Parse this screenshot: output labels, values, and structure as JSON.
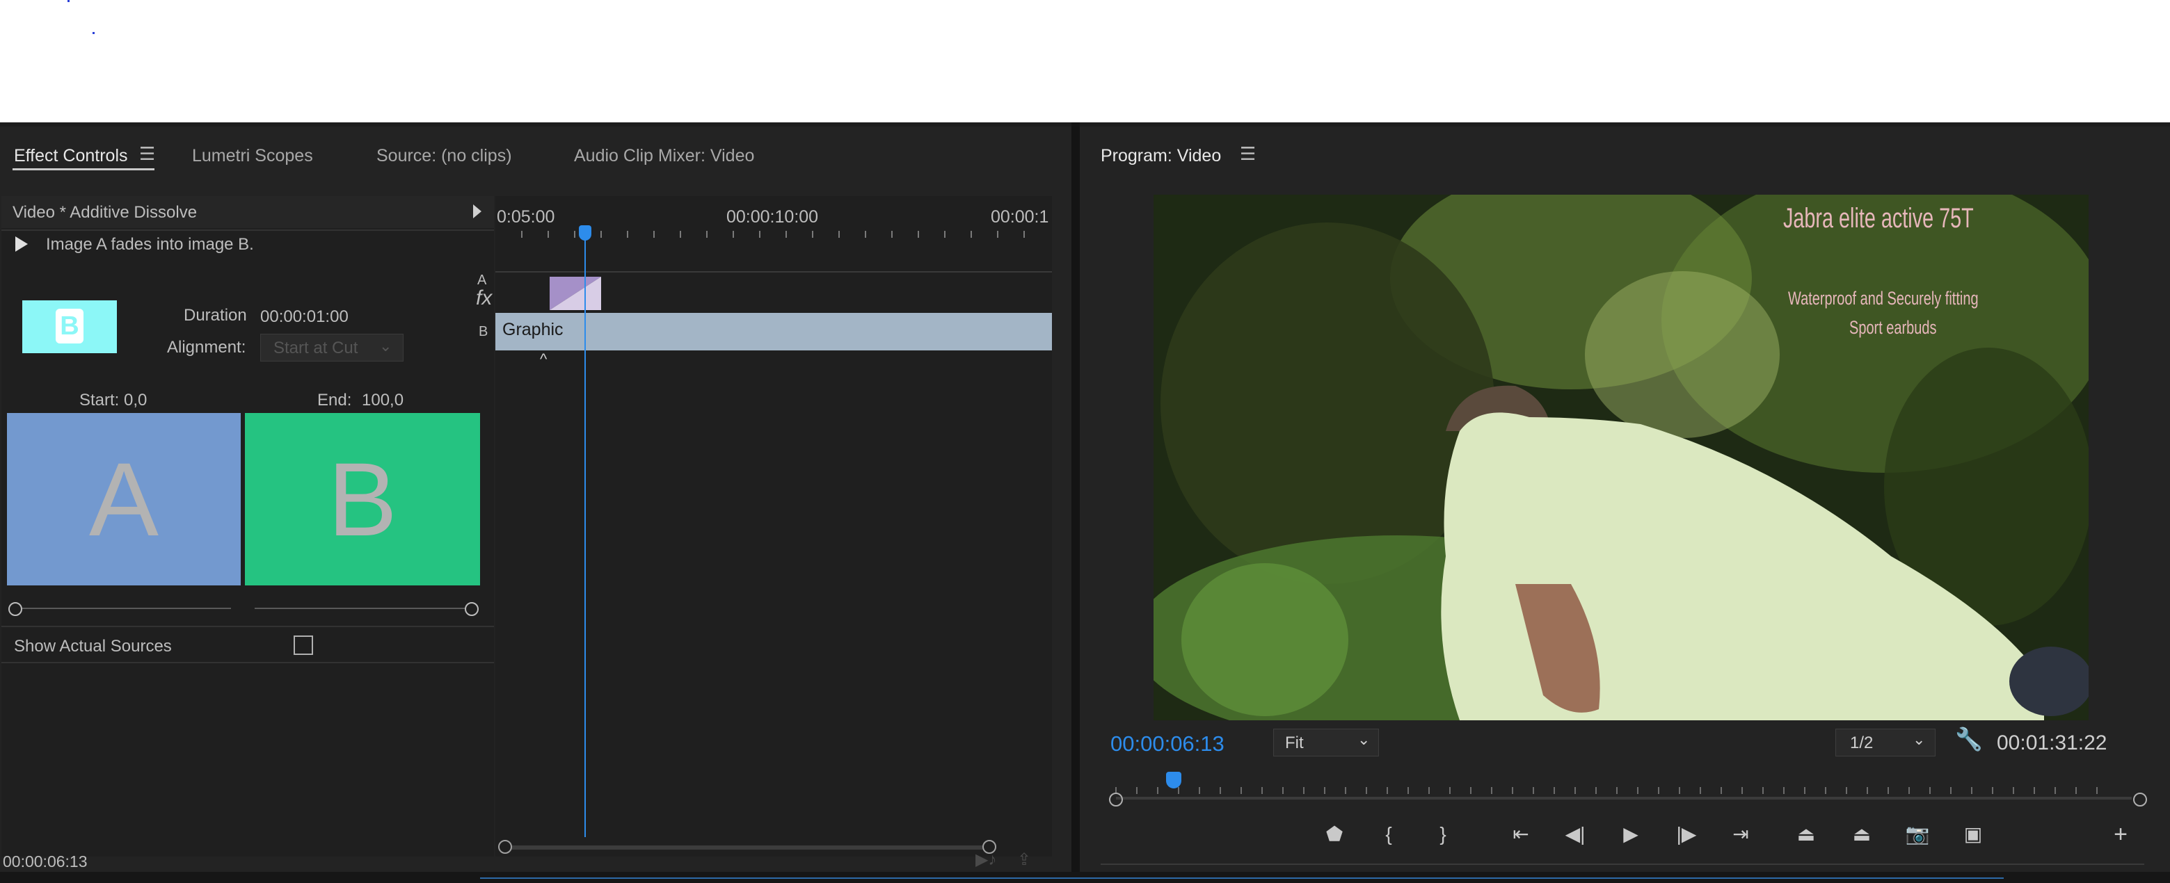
{
  "tabs": {
    "effect_controls": "Effect Controls",
    "lumetri_scopes": "Lumetri Scopes",
    "source": "Source: (no clips)",
    "audio_clip_mixer": "Audio Clip Mixer: Video",
    "program": "Program: Video"
  },
  "effect_controls": {
    "header": "Video * Additive Dissolve",
    "description": "Image A fades into image B.",
    "thumb_letter": "B",
    "duration_label": "Duration",
    "duration_value": "00:00:01:00",
    "alignment_label": "Alignment:",
    "alignment_value": "Start at Cut",
    "start_label": "Start:",
    "start_value": "0,0",
    "end_label": "End:",
    "end_value": "100,0",
    "preview_a": "A",
    "preview_b": "B",
    "show_actual_sources": "Show Actual Sources",
    "show_actual_sources_checked": false,
    "timecode": "00:00:06:13"
  },
  "mini_timeline": {
    "ticks": [
      "0:05:00",
      "00:00:10:00",
      "00:00:1"
    ],
    "track_a": "A",
    "track_b": "B",
    "fx": "fx",
    "clip_label": "Graphic"
  },
  "program": {
    "overlay_title": "Jabra elite active 75T",
    "overlay_sub1": "Waterproof and Securely fitting",
    "overlay_sub2": "Sport earbuds",
    "timecode_current": "00:00:06:13",
    "zoom": "Fit",
    "resolution": "1/2",
    "duration": "00:01:31:22"
  },
  "colors": {
    "accent": "#2d8ceb",
    "clip": "#a3b5c6",
    "transition": "#a590c8",
    "preview_a": "#7399cf",
    "preview_b": "#25c381",
    "thumb": "#8cf7f7"
  }
}
